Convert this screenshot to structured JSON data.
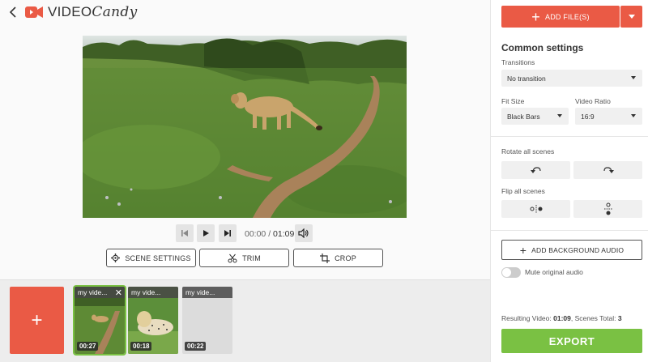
{
  "header": {
    "logo_word1": "VIDEO",
    "logo_word2": "Candy"
  },
  "player": {
    "current_time": "00:00",
    "separator": " / ",
    "total_time": "01:09"
  },
  "tools": {
    "scene_settings": "SCENE SETTINGS",
    "trim": "TRIM",
    "crop": "CROP"
  },
  "timeline": {
    "add_label": "+",
    "clips": [
      {
        "title": "my vide...",
        "duration": "00:27",
        "selected": true
      },
      {
        "title": "my vide...",
        "duration": "00:18",
        "selected": false
      },
      {
        "title": "my vide...",
        "duration": "00:22",
        "selected": false
      }
    ]
  },
  "sidebar": {
    "add_files": "ADD FILE(S)",
    "section_title": "Common settings",
    "transitions_label": "Transitions",
    "transitions_value": "No transition",
    "fit_size_label": "Fit Size",
    "fit_size_value": "Black Bars",
    "ratio_label": "Video Ratio",
    "ratio_value": "16:9",
    "rotate_label": "Rotate all scenes",
    "flip_label": "Flip all scenes",
    "bg_audio": "ADD BACKGROUND AUDIO",
    "mute_label": "Mute original audio",
    "mute_on": false,
    "result_prefix": "Resulting Video: ",
    "result_duration": "01:09",
    "result_mid": ", Scenes Total: ",
    "result_scenes": "3",
    "export": "EXPORT"
  },
  "colors": {
    "brand": "#ea5a45",
    "export": "#7ac143"
  }
}
